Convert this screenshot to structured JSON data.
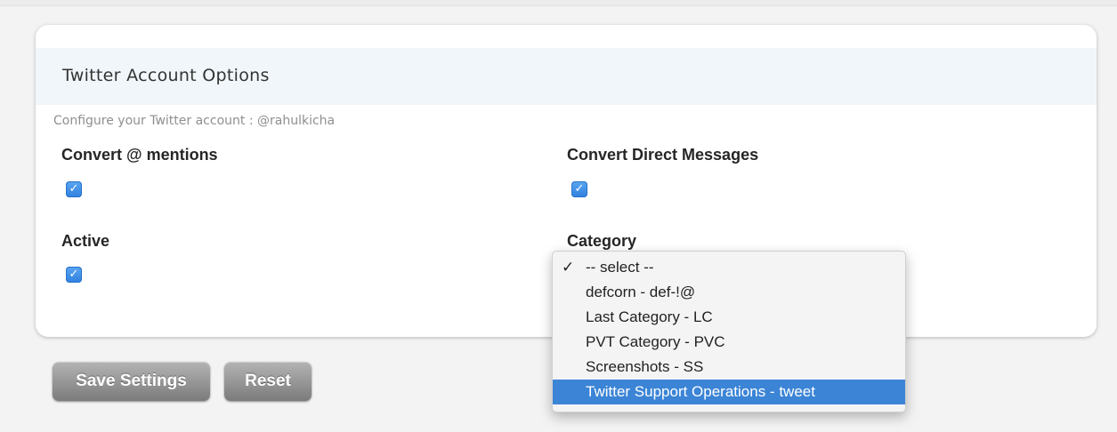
{
  "panel": {
    "title": "Twitter Account Options",
    "subtitle": "Configure your Twitter account : @rahulkicha"
  },
  "fields": {
    "convert_mentions": {
      "label": "Convert @ mentions",
      "checked": true
    },
    "convert_dms": {
      "label": "Convert Direct Messages",
      "checked": true
    },
    "active": {
      "label": "Active",
      "checked": true
    },
    "category": {
      "label": "Category",
      "selected": "-- select --"
    }
  },
  "category_options": [
    {
      "label": "-- select --",
      "checked": true
    },
    {
      "label": "defcorn - def-!@"
    },
    {
      "label": "Last Category - LC"
    },
    {
      "label": "PVT Category - PVC"
    },
    {
      "label": "Screenshots - SS"
    },
    {
      "label": "Twitter Support Operations - tweet",
      "highlighted": true
    }
  ],
  "buttons": {
    "save_label": "Save Settings",
    "reset_label": "Reset"
  },
  "icons": {
    "checkbox_check": "checkmark-icon",
    "option_check": "checkmark-icon"
  },
  "colors": {
    "checkbox": "#2f80e0",
    "highlight": "#3b84d6",
    "button": "#8e8e8e",
    "header_band": "#f1f6fa"
  }
}
